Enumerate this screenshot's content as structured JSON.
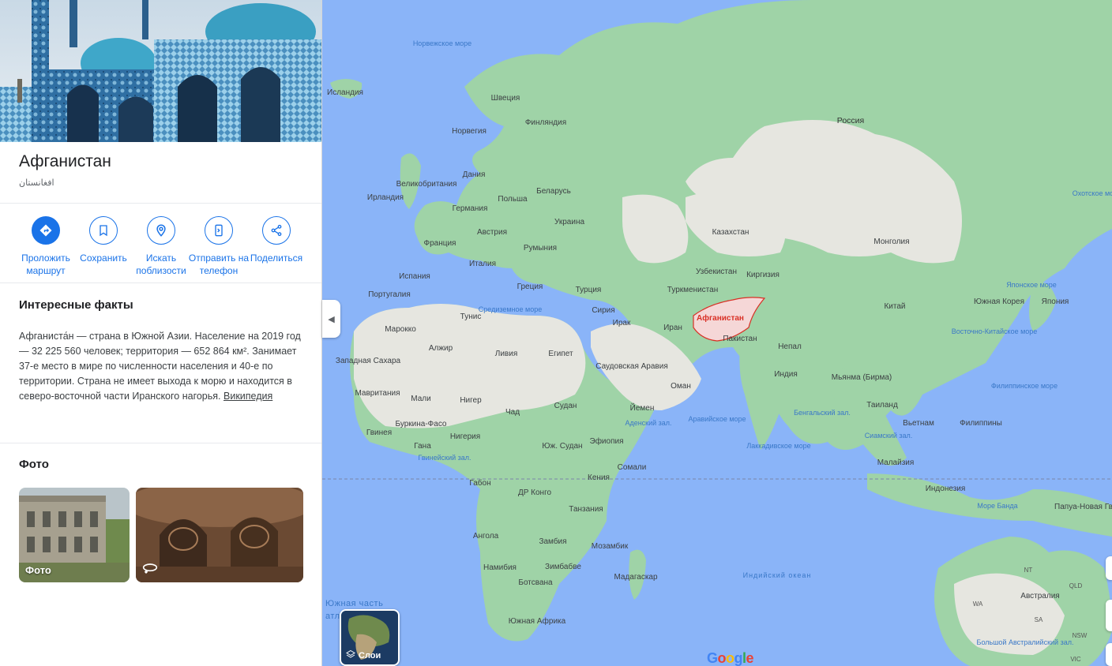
{
  "place": {
    "name": "Афганистан",
    "native_name": "افغانستان"
  },
  "actions": [
    {
      "label": "Проложить маршрут",
      "icon": "directions-icon"
    },
    {
      "label": "Сохранить",
      "icon": "bookmark-icon"
    },
    {
      "label": "Искать поблизости",
      "icon": "nearby-icon"
    },
    {
      "label": "Отправить на телефон",
      "icon": "phone-icon"
    },
    {
      "label": "Поделиться",
      "icon": "share-icon"
    }
  ],
  "facts": {
    "title": "Интересные факты",
    "text": "Афганиста́н — страна в Южной Азии. Население на 2019 год — 32 225 560 человек; территория — 652 864 км². Занимает 37-е место в мире по численности населения и 40-е по территории. Страна не имеет выхода к морю и находится в северо-восточной части Иранского нагорья.",
    "source_link": "Википедия"
  },
  "photos": {
    "title": "Фото",
    "items": [
      {
        "caption": "Фото"
      },
      {
        "caption": ""
      }
    ]
  },
  "map": {
    "layers_label": "Слои",
    "logo": "Google",
    "partial_label_1": "Южная часть",
    "partial_label_2": "атл",
    "highlight_country": "Афганистан",
    "countries": [
      "Исландия",
      "Швеция",
      "Финляндия",
      "Норвегия",
      "Дания",
      "Великобритания",
      "Ирландия",
      "Беларусь",
      "Германия",
      "Польша",
      "Австрия",
      "Украина",
      "Франция",
      "Румыния",
      "Италия",
      "Испания",
      "Португалия",
      "Греция",
      "Турция",
      "Тунис",
      "Сирия",
      "Ирак",
      "Иран",
      "Марокко",
      "Алжир",
      "Ливия",
      "Египет",
      "Западная Сахара",
      "Саудовская Аравия",
      "Оман",
      "Мавритания",
      "Мали",
      "Нигер",
      "Чад",
      "Судан",
      "Йемен",
      "Гвинея",
      "Буркина-Фасо",
      "Нигерия",
      "Эфиопия",
      "Гана",
      "Юж. Судан",
      "Сомали",
      "Габон",
      "ДР Конго",
      "Кения",
      "Танзания",
      "Ангола",
      "Замбия",
      "Мозамбик",
      "Намибия",
      "Зимбабве",
      "Ботсвана",
      "Мадагаскар",
      "Южная Африка",
      "Россия",
      "Казахстан",
      "Монголия",
      "Узбекистан",
      "Киргизия",
      "Туркменистан",
      "Пакистан",
      "Непал",
      "Индия",
      "Китай",
      "Южная Корея",
      "Япония",
      "Мьянма (Бирма)",
      "Таиланд",
      "Вьетнам",
      "Филиппины",
      "Малайзия",
      "Индонезия",
      "Папуа-Новая Гвинея",
      "Австралия"
    ],
    "seas": [
      "Норвежское море",
      "Средиземное море",
      "Гвинейский зал.",
      "Аравийское море",
      "Аденский зал.",
      "Бенгальский зал.",
      "Лаккадивское море",
      "Сиамский зал.",
      "Индийский океан",
      "Японское море",
      "Восточно-Китайское море",
      "Филиппинское море",
      "Море Банда",
      "Охотское море",
      "Большой Австралийский зал."
    ],
    "aus_regions": [
      "NT",
      "QLD",
      "WA",
      "SA",
      "NSW",
      "VIC"
    ]
  }
}
